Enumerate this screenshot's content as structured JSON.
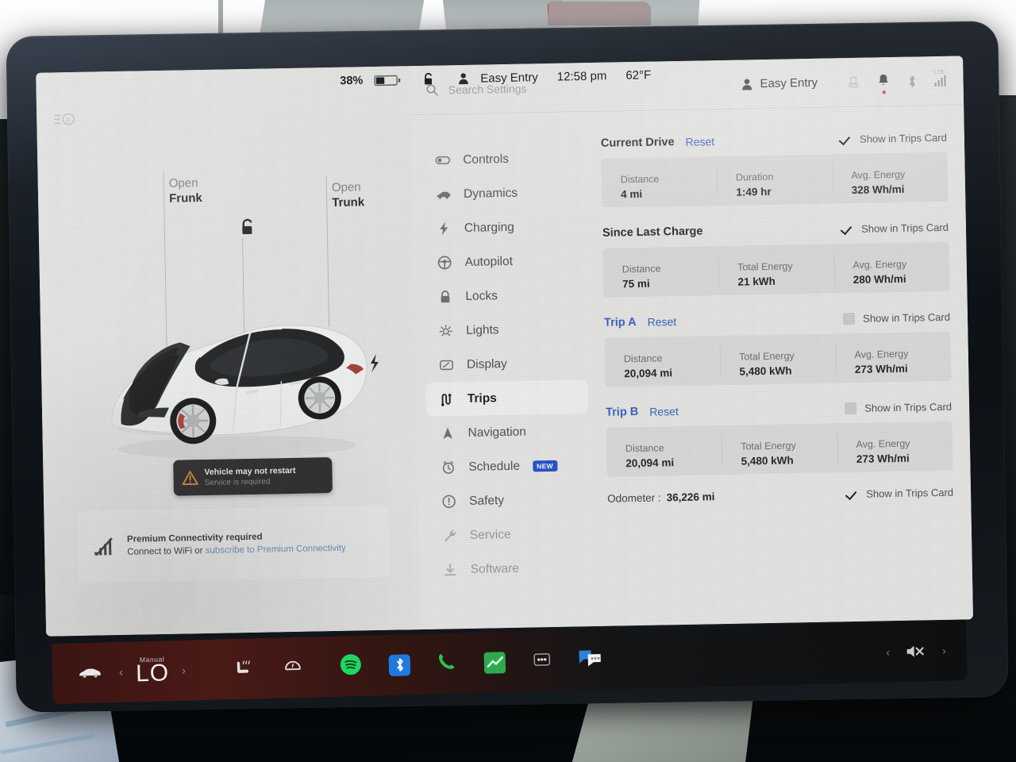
{
  "status_bar": {
    "battery_percent": "38%",
    "battery_icon": "battery-icon",
    "lock_icon": "unlock-icon",
    "profile_icon": "person-icon",
    "profile_name": "Easy Entry",
    "time": "12:58 pm",
    "temperature": "62°F"
  },
  "vehicle_panel": {
    "headlight_indicator_icon": "auto-headlight-icon",
    "frunk_callout": {
      "action": "Open",
      "target": "Frunk"
    },
    "trunk_callout": {
      "action": "Open",
      "target": "Trunk"
    },
    "unlock_icon": "unlock-icon",
    "charge_port_icon": "charge-bolt-icon",
    "alert": {
      "icon": "warning-triangle-icon",
      "title": "Vehicle may not restart",
      "subtitle": "Service is required"
    },
    "connectivity": {
      "icon": "no-signal-icon",
      "line1": "Premium Connectivity required",
      "line2_prefix": "Connect to WiFi or ",
      "line2_link": "subscribe to Premium Connectivity"
    }
  },
  "settings": {
    "search": {
      "icon": "search-icon",
      "placeholder": "Search Settings",
      "value": ""
    },
    "profile": {
      "icon": "person-icon",
      "name": "Easy Entry"
    },
    "status_icons": [
      "car-seat-icon",
      "bell-icon",
      "bluetooth-icon",
      "lte-signal-icon"
    ],
    "lte_label": "LTE",
    "nav_items": [
      {
        "label": "Controls",
        "icon": "toggle-icon",
        "selected": false,
        "faded": false,
        "badge": ""
      },
      {
        "label": "Dynamics",
        "icon": "car-icon",
        "selected": false,
        "faded": false,
        "badge": ""
      },
      {
        "label": "Charging",
        "icon": "bolt-icon",
        "selected": false,
        "faded": false,
        "badge": ""
      },
      {
        "label": "Autopilot",
        "icon": "steering-icon",
        "selected": false,
        "faded": false,
        "badge": ""
      },
      {
        "label": "Locks",
        "icon": "lock-icon",
        "selected": false,
        "faded": false,
        "badge": ""
      },
      {
        "label": "Lights",
        "icon": "sun-icon",
        "selected": false,
        "faded": false,
        "badge": ""
      },
      {
        "label": "Display",
        "icon": "display-icon",
        "selected": false,
        "faded": false,
        "badge": ""
      },
      {
        "label": "Trips",
        "icon": "trips-route-icon",
        "selected": true,
        "faded": false,
        "badge": ""
      },
      {
        "label": "Navigation",
        "icon": "navigation-arrow-icon",
        "selected": false,
        "faded": false,
        "badge": ""
      },
      {
        "label": "Schedule",
        "icon": "clock-icon",
        "selected": false,
        "faded": false,
        "badge": "NEW"
      },
      {
        "label": "Safety",
        "icon": "info-circle-icon",
        "selected": false,
        "faded": false,
        "badge": ""
      },
      {
        "label": "Service",
        "icon": "wrench-icon",
        "selected": false,
        "faded": true,
        "badge": ""
      },
      {
        "label": "Software",
        "icon": "download-icon",
        "selected": false,
        "faded": true,
        "badge": ""
      }
    ],
    "show_in_trips_card_label": "Show in Trips Card",
    "reset_label": "Reset",
    "sections": [
      {
        "title": "Current Drive",
        "title_is_link": false,
        "has_reset": true,
        "checked": true,
        "stats": [
          {
            "label": "Distance",
            "value": "4 mi"
          },
          {
            "label": "Duration",
            "value": "1:49 hr"
          },
          {
            "label": "Avg. Energy",
            "value": "328 Wh/mi"
          }
        ]
      },
      {
        "title": "Since Last Charge",
        "title_is_link": false,
        "has_reset": false,
        "checked": true,
        "stats": [
          {
            "label": "Distance",
            "value": "75 mi"
          },
          {
            "label": "Total Energy",
            "value": "21 kWh"
          },
          {
            "label": "Avg. Energy",
            "value": "280 Wh/mi"
          }
        ]
      },
      {
        "title": "Trip A",
        "title_is_link": true,
        "has_reset": true,
        "checked": false,
        "stats": [
          {
            "label": "Distance",
            "value": "20,094 mi"
          },
          {
            "label": "Total Energy",
            "value": "5,480 kWh"
          },
          {
            "label": "Avg. Energy",
            "value": "273 Wh/mi"
          }
        ]
      },
      {
        "title": "Trip B",
        "title_is_link": true,
        "has_reset": true,
        "checked": false,
        "stats": [
          {
            "label": "Distance",
            "value": "20,094 mi"
          },
          {
            "label": "Total Energy",
            "value": "5,480 kWh"
          },
          {
            "label": "Avg. Energy",
            "value": "273 Wh/mi"
          }
        ]
      }
    ],
    "odometer": {
      "label": "Odometer :",
      "value": "36,226 mi",
      "checked": true
    }
  },
  "bottom_bar": {
    "car_icon": "car-icon",
    "left_arrow": "‹",
    "right_arrow": "›",
    "manual_label": "Manual",
    "temperature": "LO",
    "seat_heater_icon": "seat-heater-icon",
    "defrost_icon": "rear-defrost-icon",
    "apps": [
      {
        "name": "spotify-icon",
        "color": "#1ED760"
      },
      {
        "name": "bluetooth-icon",
        "color": "#1f7ae0"
      },
      {
        "name": "phone-icon",
        "color": "#2bc44a"
      },
      {
        "name": "energy-app-icon",
        "color": "#2eaa4e"
      },
      {
        "name": "more-dots-icon",
        "color": "#cfcfcf"
      },
      {
        "name": "messages-icon",
        "color": "#2f7ee0"
      }
    ],
    "volume_icon": "speaker-muted-icon",
    "vol_left_arrow": "‹",
    "vol_right_arrow": "›"
  },
  "colors": {
    "accent_blue": "#2f63c8",
    "badge_blue": "#1f4fd8",
    "warning_orange": "#e08a2b",
    "screen_bg": "#e8e8e6"
  }
}
